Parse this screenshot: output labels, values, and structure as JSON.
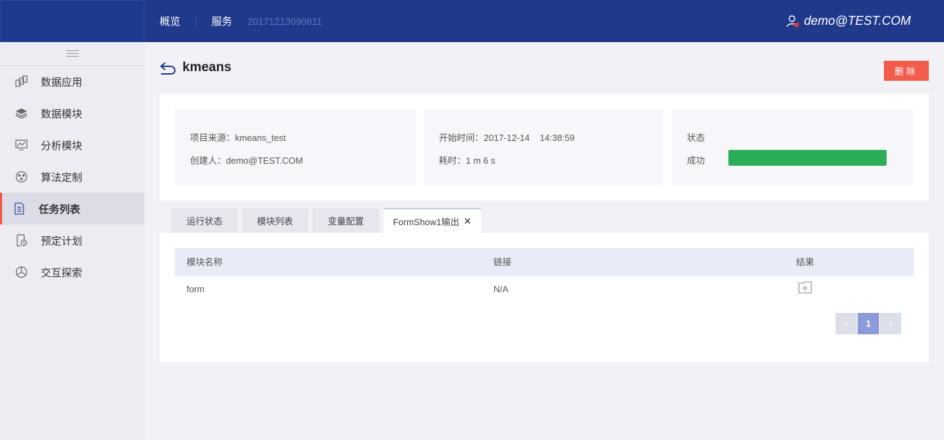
{
  "topbar": {
    "nav": [
      "概览",
      "服务"
    ],
    "crumb": "20171213090811",
    "user": "demo@TEST.COM"
  },
  "sidebar": {
    "items": [
      {
        "label": "数据应用",
        "icon": "data-app-icon"
      },
      {
        "label": "数据模块",
        "icon": "layers-icon"
      },
      {
        "label": "分析模块",
        "icon": "analysis-icon"
      },
      {
        "label": "算法定制",
        "icon": "algorithm-icon"
      },
      {
        "label": "任务列表",
        "icon": "task-list-icon",
        "active": true
      },
      {
        "label": "预定计划",
        "icon": "schedule-icon"
      },
      {
        "label": "交互探索",
        "icon": "explore-icon"
      }
    ]
  },
  "page": {
    "title": "kmeans",
    "delete_label": "删除"
  },
  "info": {
    "source": "项目来源：kmeans_test",
    "creator": "创建人：demo@TEST.COM",
    "start": "开始时间：2017-12-14    14:38:59",
    "duration": "耗时：1 m 6 s",
    "status_label": "状态",
    "status_value": "成功",
    "progress": 1.0
  },
  "tabs": [
    "运行状态",
    "模块列表",
    "变量配置",
    "FormShow1输出"
  ],
  "table": {
    "headers": [
      "模块名称",
      "链接",
      "结果"
    ],
    "rows": [
      {
        "name": "form",
        "link": "N/A"
      }
    ]
  },
  "pagination": {
    "prev": "‹",
    "current": "1",
    "next": "›"
  },
  "colors": {
    "topbar": "#20398b",
    "accent": "#f25c4a",
    "success": "#2cae59",
    "page_active": "#8c9ad9"
  }
}
